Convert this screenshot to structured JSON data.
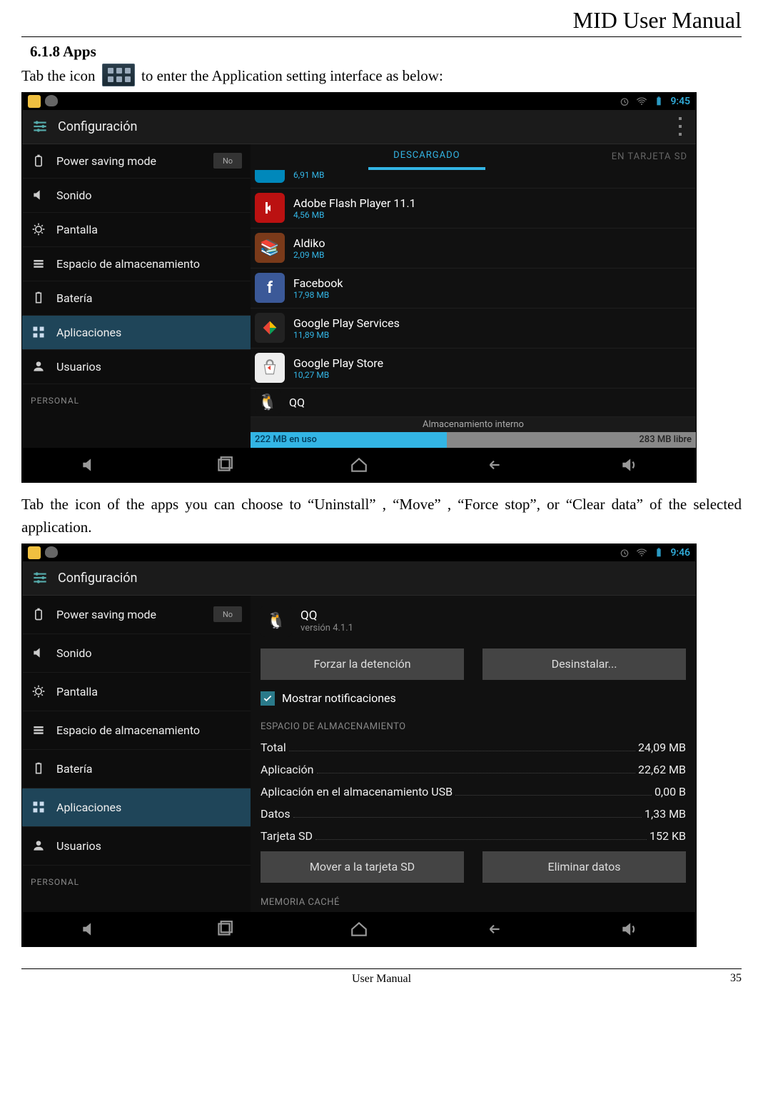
{
  "doc": {
    "title": "MID User Manual",
    "section_heading": "6.1.8 Apps",
    "intro_pre": "Tab the icon ",
    "intro_post": " to enter the Application setting interface as below:",
    "paragraph2": "Tab the icon of the apps you can choose to “Uninstall” , “Move” , “Force stop”, or “Clear data” of the selected application.",
    "footer_center": "User Manual",
    "page_number": "35"
  },
  "statusbar": {
    "clock": "9:45",
    "clock2": "9:46"
  },
  "actionbar": {
    "title": "Configuración"
  },
  "sidebar": {
    "items": [
      {
        "label": "Power saving mode",
        "toggle": "No"
      },
      {
        "label": "Sonido"
      },
      {
        "label": "Pantalla"
      },
      {
        "label": "Espacio de almacenamiento"
      },
      {
        "label": "Batería"
      },
      {
        "label": "Aplicaciones",
        "selected": true
      },
      {
        "label": "Usuarios"
      }
    ],
    "section_header": "PERSONAL"
  },
  "apps_pane": {
    "tabs": {
      "active": "DESCARGADO",
      "right": "EN TARJETA SD"
    },
    "cut_size": "6,91 MB",
    "apps": [
      {
        "name": "Adobe Flash Player 11.1",
        "size": "4,56 MB",
        "color": "#b11"
      },
      {
        "name": "Aldiko",
        "size": "2,09 MB",
        "color": "#7a3a1a"
      },
      {
        "name": "Facebook",
        "size": "17,98 MB",
        "color": "#3b5998"
      },
      {
        "name": "Google Play Services",
        "size": "11,89 MB",
        "color": "#222"
      },
      {
        "name": "Google Play Store",
        "size": "10,27 MB",
        "color": "#eee"
      },
      {
        "name": "QQ",
        "size": "",
        "color": "#111"
      }
    ],
    "storage": {
      "label": "Almacenamiento interno",
      "used": "222 MB en uso",
      "free": "283 MB libre"
    }
  },
  "detail": {
    "app_name": "QQ",
    "version": "versión 4.1.1",
    "buttons": {
      "force_stop": "Forzar la detención",
      "uninstall": "Desinstalar..."
    },
    "show_notifications": "Mostrar notificaciones",
    "storage_header": "ESPACIO DE ALMACENAMIENTO",
    "rows": [
      {
        "k": "Total",
        "v": "24,09 MB"
      },
      {
        "k": "Aplicación",
        "v": "22,62 MB"
      },
      {
        "k": "Aplicación en el almacenamiento USB",
        "v": "0,00 B"
      },
      {
        "k": "Datos",
        "v": "1,33 MB"
      },
      {
        "k": "Tarjeta SD",
        "v": "152 KB"
      }
    ],
    "buttons2": {
      "move_sd": "Mover a la tarjeta SD",
      "clear_data": "Eliminar datos"
    },
    "cache_header": "MEMORIA CACHÉ"
  }
}
